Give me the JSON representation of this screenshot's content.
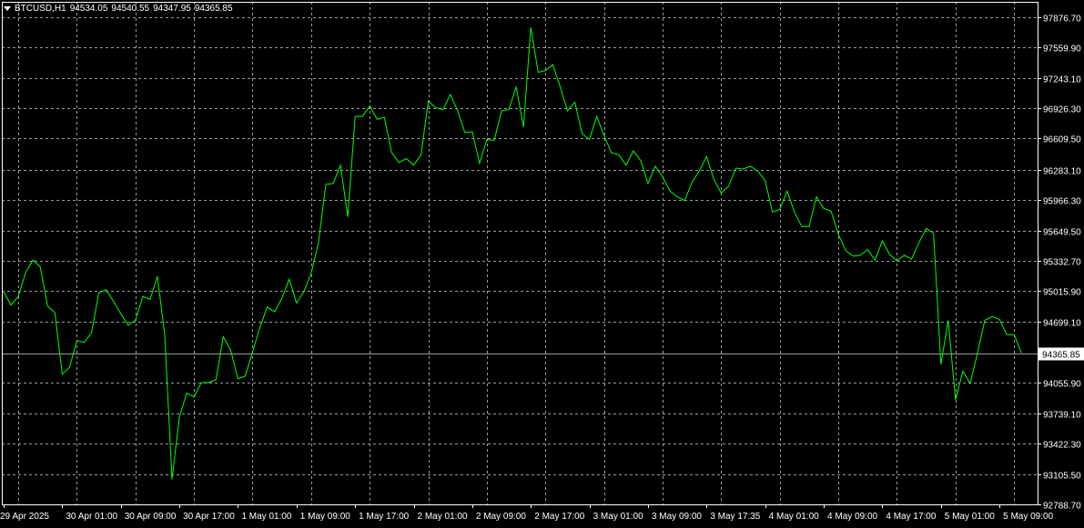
{
  "header": {
    "symbol": "BTCUSD,H1",
    "open": "94534.05",
    "high": "94540.55",
    "low": "94347.95",
    "close": "94365.85",
    "icon": "dropdown-triangle-icon"
  },
  "colors": {
    "background": "#000000",
    "line": "#00FF00",
    "grid": "#9A9A9A",
    "axis_text": "#FFFFFF",
    "price_line": "#9A9A9A"
  },
  "chart_data": {
    "type": "line",
    "symbol": "BTCUSD",
    "timeframe": "H1",
    "grid": true,
    "ylim": [
      92788.7,
      98036.56
    ],
    "yticks": [
      97876.7,
      97559.9,
      97243.1,
      96926.3,
      96609.5,
      96283.1,
      95966.3,
      95649.5,
      95332.7,
      95015.9,
      94699.1,
      94055.9,
      93739.1,
      93422.3,
      93105.5,
      92788.7
    ],
    "ytick_labels": [
      "97876.70",
      "97559.90",
      "97243.10",
      "96926.30",
      "96609.50",
      "96283.10",
      "95966.30",
      "95649.50",
      "95332.70",
      "95015.90",
      "94699.10",
      "94055.90",
      "93739.10",
      "93422.30",
      "93105.50",
      "92788.70"
    ],
    "current_price": 94365.85,
    "current_price_label": "94365.85",
    "xtick_labels": [
      "29 Apr 2025",
      "30 Apr 01:00",
      "30 Apr 09:00",
      "30 Apr 17:00",
      "1 May 01:00",
      "1 May 09:00",
      "1 May 17:00",
      "2 May 01:00",
      "2 May 09:00",
      "2 May 17:00",
      "3 May 01:00",
      "3 May 09:00",
      "3 May 17:35",
      "4 May 01:00",
      "4 May 09:00",
      "4 May 17:00",
      "5 May 01:00",
      "5 May 09:00"
    ],
    "xtick_index": [
      0,
      8,
      16,
      24,
      32,
      40,
      48,
      56,
      64,
      72,
      80,
      88,
      96,
      104,
      112,
      120,
      128,
      136
    ],
    "series": [
      {
        "values": [
          95010,
          94870,
          94960,
          95210,
          95340,
          95270,
          94860,
          94790,
          94150,
          94220,
          94500,
          94480,
          94580,
          95000,
          95030,
          94910,
          94780,
          94660,
          94710,
          94960,
          94930,
          95170,
          94560,
          93050,
          93700,
          93950,
          93910,
          94060,
          94060,
          94090,
          94540,
          94400,
          94100,
          94130,
          94380,
          94640,
          94850,
          94800,
          94940,
          95140,
          94890,
          95010,
          95200,
          95520,
          96130,
          96140,
          96330,
          95790,
          96840,
          96840,
          96950,
          96810,
          96830,
          96460,
          96360,
          96400,
          96330,
          96440,
          97000,
          96930,
          96910,
          97070,
          96900,
          96670,
          96680,
          96350,
          96600,
          96590,
          96900,
          96910,
          97150,
          96730,
          97770,
          97300,
          97320,
          97380,
          97150,
          96900,
          96990,
          96660,
          96600,
          96840,
          96640,
          96460,
          96440,
          96330,
          96480,
          96380,
          96140,
          96320,
          96210,
          96060,
          96000,
          95960,
          96150,
          96270,
          96420,
          96180,
          96040,
          96110,
          96300,
          96290,
          96320,
          96270,
          96170,
          95840,
          95870,
          96060,
          95840,
          95690,
          95690,
          96000,
          95880,
          95850,
          95610,
          95440,
          95380,
          95390,
          95450,
          95340,
          95540,
          95400,
          95330,
          95390,
          95350,
          95520,
          95670,
          95620,
          94250,
          94710,
          93880,
          94180,
          94050,
          94370,
          94710,
          94750,
          94720,
          94560,
          94560,
          94370
        ]
      }
    ]
  }
}
